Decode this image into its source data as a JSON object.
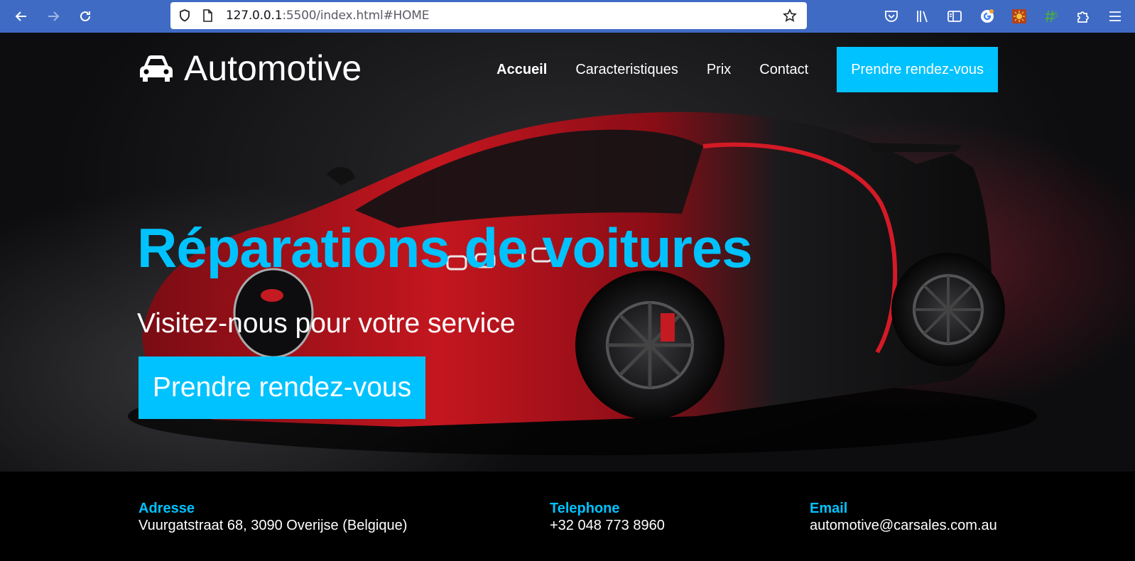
{
  "browser": {
    "url_host": "127.0.0.1",
    "url_rest": ":5500/index.html#HOME",
    "icons": [
      "back-arrow-icon",
      "forward-arrow-icon",
      "reload-icon",
      "shield-icon",
      "page-icon",
      "star-icon",
      "pocket-icon",
      "library-icon",
      "sidebar-icon",
      "extension-icon",
      "puzzle-icon",
      "menu-icon"
    ]
  },
  "header": {
    "brand": "Automotive",
    "brand_icon": "car-icon",
    "nav": [
      {
        "label": "Accueil",
        "active": true
      },
      {
        "label": "Caracteristiques",
        "active": false
      },
      {
        "label": "Prix",
        "active": false
      },
      {
        "label": "Contact",
        "active": false
      }
    ],
    "cta": "Prendre rendez-vous"
  },
  "hero": {
    "title": "Réparations de voitures",
    "subtitle": "Visitez-nous pour votre service",
    "button": "Prendre rendez-vous"
  },
  "footer": {
    "address": {
      "label": "Adresse",
      "value": "Vuurgatstraat 68, 3090 Overijse (Belgique)"
    },
    "phone": {
      "label": "Telephone",
      "value": "+32 048 773 8960"
    },
    "email": {
      "label": "Email",
      "value": "automotive@carsales.com.au"
    }
  },
  "colors": {
    "accent": "#00c2ff",
    "chrome": "#3f6bc4",
    "car_red": "#b3141f"
  }
}
